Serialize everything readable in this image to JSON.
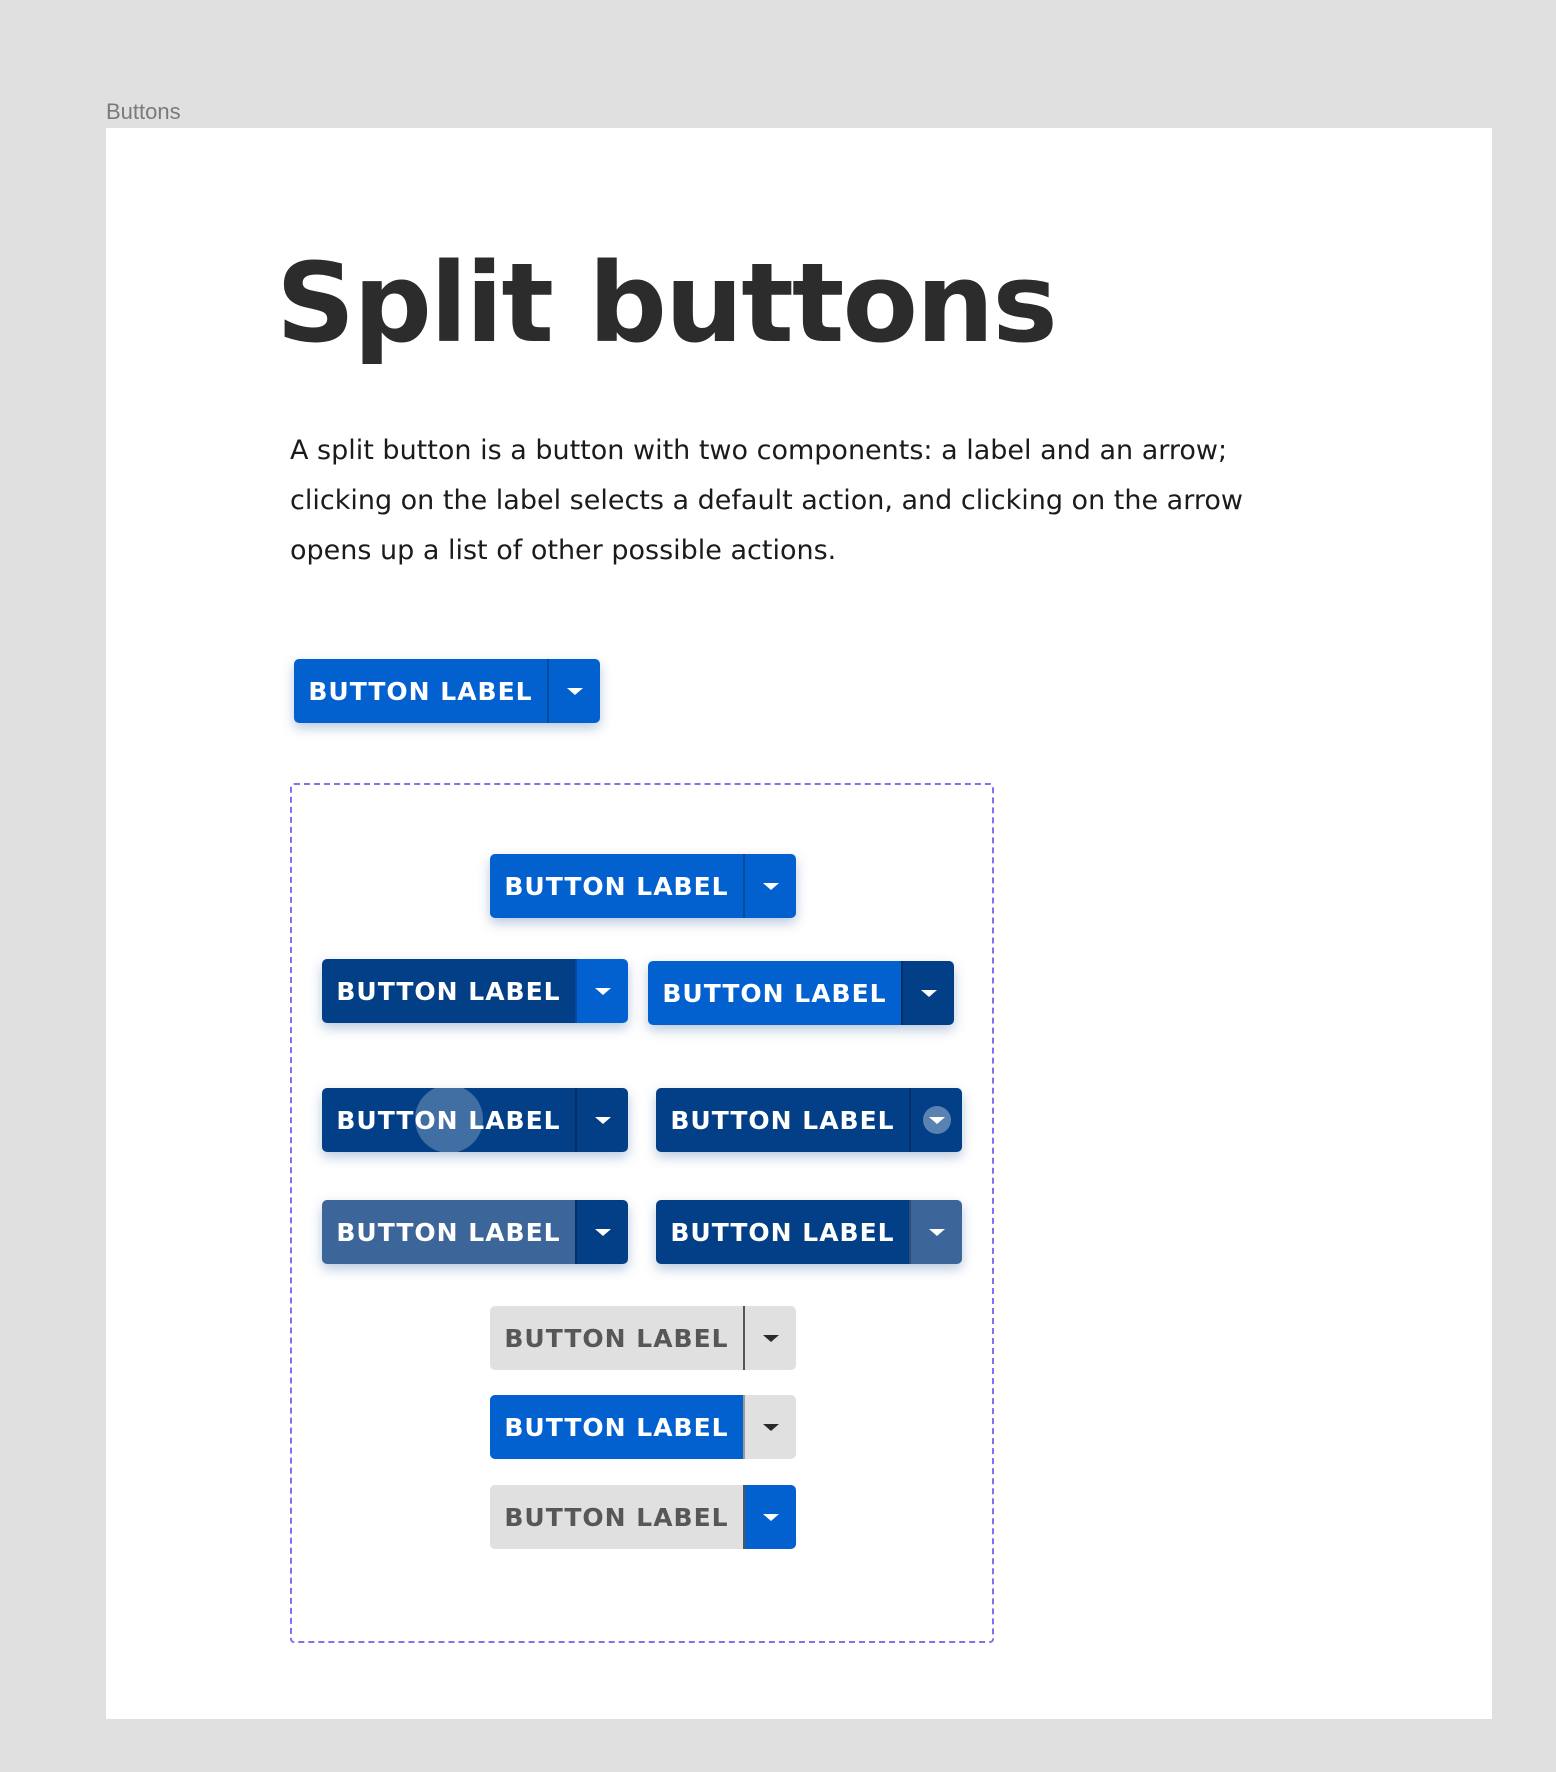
{
  "frame": {
    "label": "Buttons"
  },
  "page": {
    "title": "Split buttons",
    "description": "A split button is a button with two components: a label and an arrow; clicking on the label selects a default action, and clicking on the arrow opens up a list of other possible actions."
  },
  "colors": {
    "primary": "#0360cf",
    "primary_dark": "#023f86",
    "muted": "#3c6599",
    "disabled_bg": "#e0e0e0",
    "disabled_text": "#575757",
    "variants_border": "#8a6cf0",
    "background": "#e0e0e0"
  },
  "icons": {
    "arrow": "chevron-down-icon"
  },
  "buttons": {
    "default": {
      "label": "BUTTON LABEL"
    },
    "enabled": {
      "label": "BUTTON LABEL"
    },
    "hover_label": {
      "label": "BUTTON LABEL"
    },
    "hover_arrow": {
      "label": "BUTTON LABEL"
    },
    "pressed_label": {
      "label": "BUTTON LABEL"
    },
    "focused_arrow": {
      "label": "BUTTON LABEL"
    },
    "active_label": {
      "label": "BUTTON LABEL"
    },
    "active_arrow": {
      "label": "BUTTON LABEL"
    },
    "disabled": {
      "label": "BUTTON LABEL"
    },
    "arrow_disabled": {
      "label": "BUTTON LABEL"
    },
    "label_disabled": {
      "label": "BUTTON LABEL"
    }
  }
}
